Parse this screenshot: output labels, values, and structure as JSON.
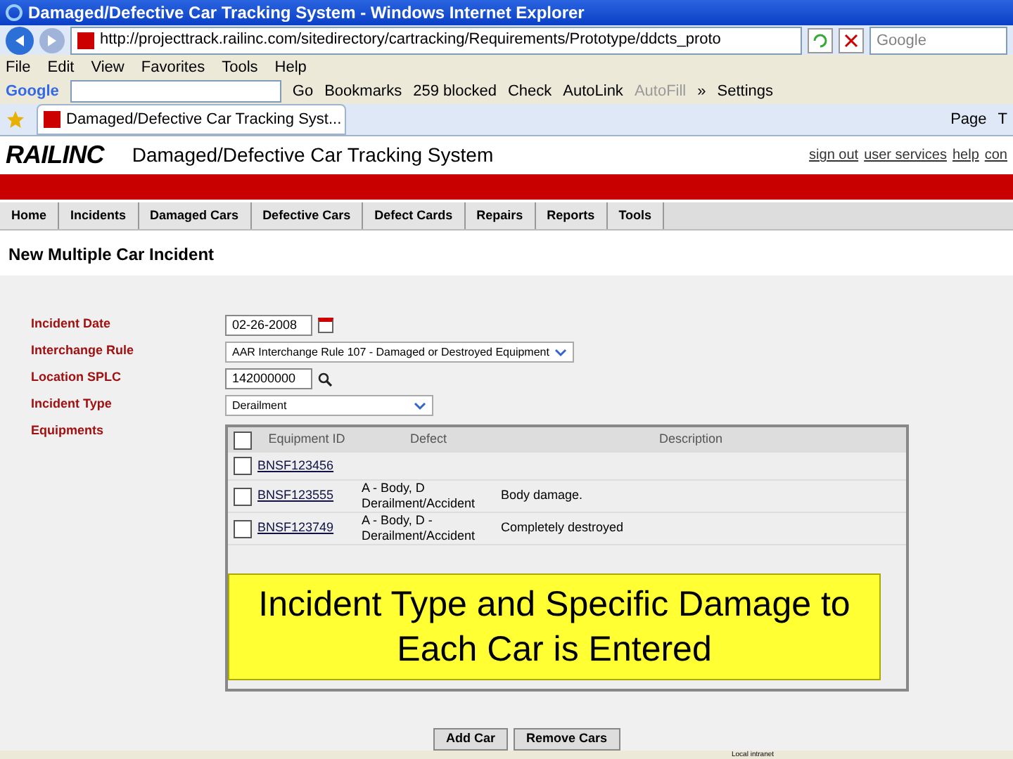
{
  "window": {
    "title": "Damaged/Defective Car Tracking System - Windows Internet Explorer"
  },
  "address_bar": {
    "url": "http://projecttrack.railinc.com/sitedirectory/cartracking/Requirements/Prototype/ddcts_proto",
    "search_placeholder": "Google"
  },
  "menu": [
    "File",
    "Edit",
    "View",
    "Favorites",
    "Tools",
    "Help"
  ],
  "google_toolbar": {
    "logo": "Google",
    "go": "Go",
    "items": [
      "Bookmarks",
      "259 blocked",
      "Check",
      "AutoLink",
      "AutoFill"
    ],
    "more": "»",
    "settings": "Settings"
  },
  "tab": {
    "title": "Damaged/Defective Car Tracking Syst..."
  },
  "command_bar": [
    "Page",
    "T"
  ],
  "header": {
    "logo": "RAILINC",
    "title": "Damaged/Defective Car Tracking System",
    "links": [
      "sign out",
      "user services",
      "help",
      "con"
    ]
  },
  "nav": [
    {
      "label": "Home",
      "selected": false
    },
    {
      "label": "Incidents",
      "selected": false
    },
    {
      "label": "Damaged Cars",
      "selected": false
    },
    {
      "label": "Defective Cars",
      "selected": false
    },
    {
      "label": "Defect Cards",
      "selected": false
    },
    {
      "label": "Repairs",
      "selected": false
    },
    {
      "label": "Reports",
      "selected": false
    },
    {
      "label": "Tools",
      "selected": false
    }
  ],
  "page_title": "New Multiple Car Incident",
  "form": {
    "incident_date_label": "Incident Date",
    "incident_date": "02-26-2008",
    "interchange_rule_label": "Interchange Rule",
    "interchange_rule": "AAR Interchange Rule 107 - Damaged or Destroyed Equipment",
    "location_label": "Location SPLC",
    "location": "142000000",
    "incident_type_label": "Incident Type",
    "incident_type": "Derailment",
    "equipments_label": "Equipments"
  },
  "table": {
    "select_all_checked": false,
    "columns": [
      "Equipment ID",
      "Defect",
      "Description"
    ],
    "rows": [
      {
        "id": "BNSF123456",
        "defect": "",
        "description": "",
        "checked": false
      },
      {
        "id": "BNSF123555",
        "defect": "A - Body, D Derailment/Accident",
        "description": "Body damage.",
        "checked": false
      },
      {
        "id": "BNSF123749",
        "defect": "A - Body, D - Derailment/Accident",
        "description": "Completely destroyed",
        "checked": false
      }
    ]
  },
  "callout": "Incident Type and Specific Damage to Each Car is Entered",
  "buttons": [
    "Add Car",
    "Remove Cars"
  ],
  "status_bar": {
    "zone": "Local intranet"
  }
}
